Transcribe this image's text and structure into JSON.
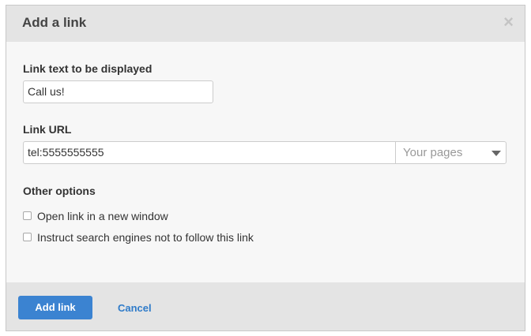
{
  "dialog": {
    "title": "Add a link",
    "close_glyph": "×",
    "close_icon": "close-icon"
  },
  "link_text": {
    "label": "Link text to be displayed",
    "value": "Call us!"
  },
  "link_url": {
    "label": "Link URL",
    "value": "tel:5555555555",
    "select_value": "Your pages",
    "select_icon": "chevron-down-icon"
  },
  "other_options": {
    "label": "Other options",
    "items": [
      {
        "label": "Open link in a new window",
        "checked": false
      },
      {
        "label": "Instruct search engines not to follow this link",
        "checked": false
      }
    ]
  },
  "footer": {
    "add_label": "Add link",
    "cancel_label": "Cancel"
  },
  "colors": {
    "primary": "#3b83d1",
    "link": "#2f7bc9",
    "header_bg": "#e4e4e4"
  }
}
